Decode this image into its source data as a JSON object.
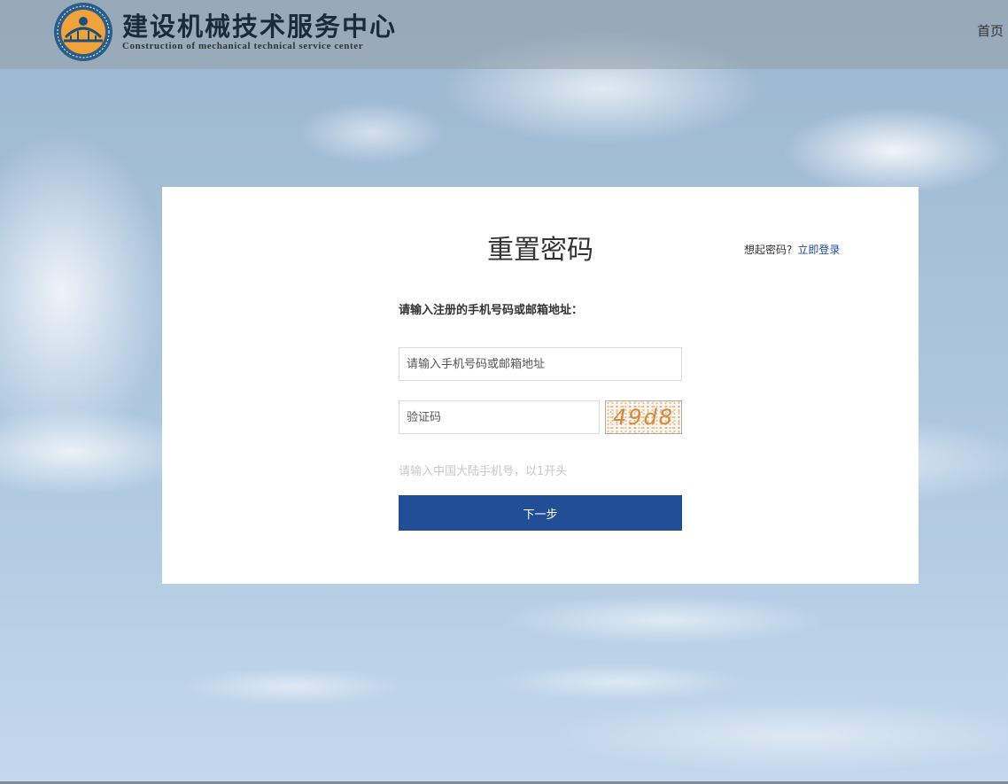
{
  "header": {
    "logo_title": "建设机械技术服务中心",
    "logo_subtitle": "Construction of mechanical technical service center",
    "nav_home": "首页"
  },
  "reset": {
    "title": "重置密码",
    "remember_text": "想起密码?",
    "login_link": "立即登录",
    "prompt": "请输入注册的手机号码或邮箱地址：",
    "account_placeholder": "请输入手机号码或邮箱地址",
    "code_placeholder": "验证码",
    "captcha_text": "49d8",
    "hint": "请输入中国大陆手机号，以1开头",
    "next_button": "下一步"
  },
  "colors": {
    "primary_button": "#224d97",
    "link": "#1f4a93",
    "captcha_text": "#d48a3a"
  }
}
